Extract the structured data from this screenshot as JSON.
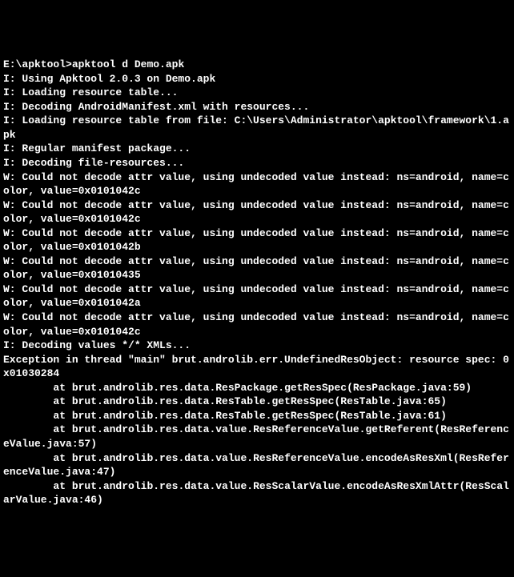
{
  "terminal": {
    "prompt_path": "E:\\apktool>",
    "command": "apktool d Demo.apk",
    "lines": [
      "I: Using Apktool 2.0.3 on Demo.apk",
      "I: Loading resource table...",
      "I: Decoding AndroidManifest.xml with resources...",
      "I: Loading resource table from file: C:\\Users\\Administrator\\apktool\\framework\\1.apk",
      "I: Regular manifest package...",
      "I: Decoding file-resources...",
      "W: Could not decode attr value, using undecoded value instead: ns=android, name=color, value=0x0101042c",
      "W: Could not decode attr value, using undecoded value instead: ns=android, name=color, value=0x0101042c",
      "W: Could not decode attr value, using undecoded value instead: ns=android, name=color, value=0x0101042b",
      "W: Could not decode attr value, using undecoded value instead: ns=android, name=color, value=0x01010435",
      "W: Could not decode attr value, using undecoded value instead: ns=android, name=color, value=0x0101042a",
      "W: Could not decode attr value, using undecoded value instead: ns=android, name=color, value=0x0101042c",
      "I: Decoding values */* XMLs...",
      "Exception in thread \"main\" brut.androlib.err.UndefinedResObject: resource spec: 0x01030284",
      "        at brut.androlib.res.data.ResPackage.getResSpec(ResPackage.java:59)",
      "        at brut.androlib.res.data.ResTable.getResSpec(ResTable.java:65)",
      "        at brut.androlib.res.data.ResTable.getResSpec(ResTable.java:61)",
      "        at brut.androlib.res.data.value.ResReferenceValue.getReferent(ResReferenceValue.java:57)",
      "        at brut.androlib.res.data.value.ResReferenceValue.encodeAsResXml(ResReferenceValue.java:47)",
      "        at brut.androlib.res.data.value.ResScalarValue.encodeAsResXmlAttr(ResScalarValue.java:46)"
    ]
  }
}
